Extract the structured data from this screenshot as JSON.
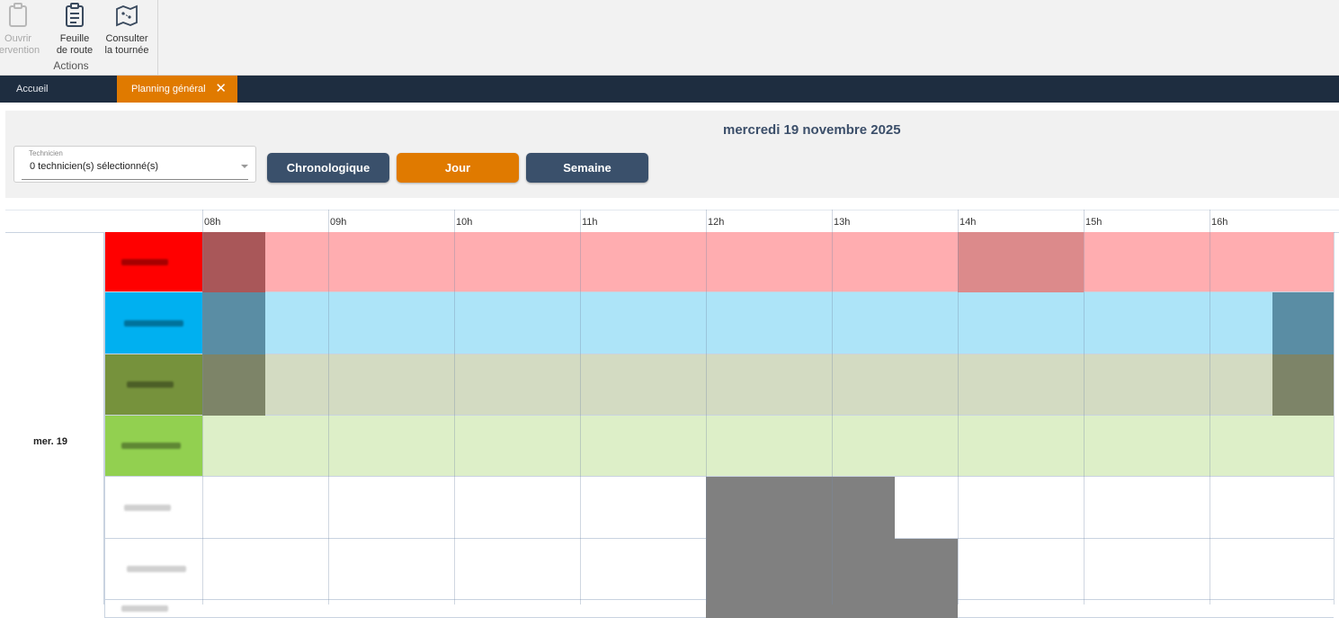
{
  "ribbon": {
    "buttons": [
      {
        "label": "Ouvrir\ntervention",
        "icon": "clipboard-icon",
        "enabled": false
      },
      {
        "label": "Feuille\nde route",
        "icon": "clipboard-list-icon",
        "enabled": true
      },
      {
        "label": "Consulter\nla tournée",
        "icon": "map-icon",
        "enabled": true
      }
    ],
    "group_title": "Actions"
  },
  "tabs": [
    {
      "label": "Accueil",
      "active": false
    },
    {
      "label": "Planning général",
      "active": true,
      "closable": true
    }
  ],
  "filters": {
    "date_title": "mercredi 19 novembre 2025",
    "technician_label": "Technicien",
    "technician_value": "0 technicien(s) sélectionné(s)",
    "view_buttons": [
      {
        "label": "Chronologique",
        "active": false
      },
      {
        "label": "Jour",
        "active": true
      },
      {
        "label": "Semaine",
        "active": false
      }
    ]
  },
  "colors": {
    "accent": "#e07a00",
    "button_dark": "#3a506b",
    "tabbar": "#1e2d40",
    "title": "#3c4f6a"
  },
  "planning": {
    "hours": [
      "08h",
      "09h",
      "10h",
      "11h",
      "12h",
      "13h",
      "14h",
      "15h",
      "16h"
    ],
    "day_label": "mer. 19",
    "technicians": [
      {
        "color": "#ff0000",
        "row_bg": "#ffadb0",
        "block_color": "#a95759",
        "blocks": [
          [
            8.0,
            8.5
          ],
          [
            14.0,
            15.0
          ]
        ],
        "block2_color": "#dc8a8b"
      },
      {
        "color": "#00b0f0",
        "row_bg": "#ade4f8",
        "block_color": "#5a8da4",
        "blocks": [
          [
            8.0,
            8.5
          ],
          [
            16.5,
            17.0
          ]
        ]
      },
      {
        "color": "#76923c",
        "row_bg": "#d3dbc2",
        "block_color": "#7d8468",
        "blocks": [
          [
            8.0,
            8.5
          ],
          [
            16.5,
            17.0
          ]
        ]
      },
      {
        "color": "#92d050",
        "row_bg": "#ddefc8",
        "block_color": "",
        "blocks": []
      },
      {
        "color": "#ffffff",
        "row_bg": "#ffffff",
        "block_color": "#808080",
        "blocks": [
          [
            12.0,
            13.5
          ]
        ]
      },
      {
        "color": "#ffffff",
        "row_bg": "#ffffff",
        "block_color": "#808080",
        "blocks": [
          [
            12.0,
            14.0
          ]
        ]
      },
      {
        "color": "#ffffff",
        "row_bg": "#ffffff",
        "block_color": "#808080",
        "blocks": [
          [
            12.0,
            14.0
          ]
        ]
      }
    ]
  }
}
